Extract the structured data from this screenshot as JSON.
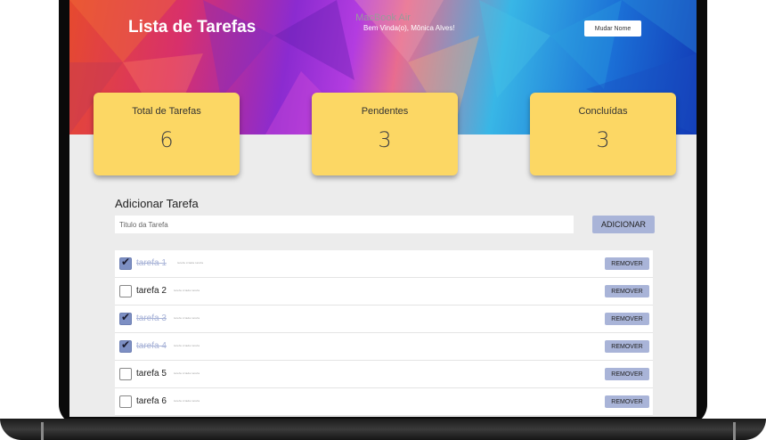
{
  "header": {
    "title": "Lista de Tarefas",
    "welcome": "Bem Vinda(o), Mônica Alves!",
    "change_name_label": "Mudar Nome"
  },
  "stats": [
    {
      "label": "Total de Tarefas",
      "value": "6"
    },
    {
      "label": "Pendentes",
      "value": "3"
    },
    {
      "label": "Concluídas",
      "value": "3"
    }
  ],
  "add_task": {
    "title": "Adicionar Tarefa",
    "placeholder": "Titulo da Tarefa",
    "button_label": "ADICIONAR"
  },
  "tasks": [
    {
      "name": "tarefa 1",
      "desc": "tarefa criada tarefa",
      "done": true,
      "remove_label": "REMOVER"
    },
    {
      "name": "tarefa 2",
      "desc": "tarefa criada tarefa",
      "done": false,
      "remove_label": "REMOVER"
    },
    {
      "name": "tarefa 3",
      "desc": "tarefa criada tarefa",
      "done": true,
      "remove_label": "REMOVER"
    },
    {
      "name": "tarefa 4",
      "desc": "tarefa criada tarefa",
      "done": true,
      "remove_label": "REMOVER"
    },
    {
      "name": "tarefa 5",
      "desc": "tarefa criada tarefa",
      "done": false,
      "remove_label": "REMOVER"
    },
    {
      "name": "tarefa 6",
      "desc": "tarefa criada tarefa",
      "done": false,
      "remove_label": "REMOVER"
    }
  ],
  "device": {
    "label": "MacBook Air"
  },
  "colors": {
    "card": "#fcd764",
    "accent_button": "#a9b4d8",
    "checked": "#7d8fc3"
  }
}
